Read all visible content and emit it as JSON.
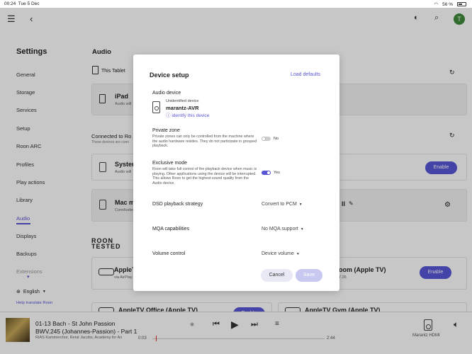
{
  "status_bar": {
    "time": "00:24",
    "date": "Tue 5 Dec",
    "battery": "56 %"
  },
  "top_bar": {
    "user_initial": "T"
  },
  "sidebar": {
    "title": "Settings",
    "items": [
      "General",
      "Storage",
      "Services",
      "Setup",
      "Roon ARC",
      "Profiles",
      "Play actions",
      "Library",
      "Audio",
      "Displays",
      "Backups",
      "Extensions"
    ],
    "active": "Audio",
    "language": "English",
    "help_link": "Help translate Roon"
  },
  "main": {
    "title": "Audio",
    "this_tablet": "This Tablet",
    "ipad_title": "iPad",
    "ipad_sub": "Audio will",
    "connected_header": "Connected to Ro",
    "connected_sub": "These devices are conn",
    "system_title": "System",
    "system_sub": "Audio will",
    "mac_title": "Mac m",
    "mac_sub": "CoreAudio",
    "grey_card_suffix": "ll",
    "enable_label": "Enable",
    "roon_tested": "ROON TESTED",
    "appletv1_title": "AppleT",
    "appletv1_sub": "via AirPlay",
    "appletv2_title": "oom (Apple TV)",
    "appletv2_sub": "7.26",
    "appletv_office": "AppleTV Office (Apple TV)",
    "appletv_gym": "AppleTV Gym (Apple TV)"
  },
  "dialog": {
    "title": "Device setup",
    "load_defaults": "Load defaults",
    "audio_device_label": "Audio device",
    "device_status": "Unidentified device",
    "device_name": "marantz-AVR",
    "identify_link": "identify this device",
    "private_zone": {
      "label": "Private zone",
      "description": "Private zones can only be controlled from the machine where the audio hardware resides. They do not participate in grouped playback.",
      "value": "No"
    },
    "exclusive_mode": {
      "label": "Exclusive mode",
      "description": "Roon will take full control of the playback device when music is playing. Other applications using the device will be interrupted. This allows Roon to get the highest sound quality from the Audio device.",
      "value": "Yes"
    },
    "dsd_strategy": {
      "label": "DSD playback strategy",
      "value": "Convert to PCM"
    },
    "mqa": {
      "label": "MQA capabilities",
      "value": "No MQA support"
    },
    "volume": {
      "label": "Volume control",
      "value": "Device volume"
    },
    "cancel": "Cancel",
    "save": "Save"
  },
  "player": {
    "line1": "01-13 Bach - St John Passion",
    "line2": "BWV.245 (Johannes-Passion) - Part 1",
    "line3": "RIAS Kammerchor, René Jacobs, Academy for An",
    "elapsed": "0:03",
    "duration": "2:44",
    "zone": "Marantz HDMI",
    "progress": 0.02
  },
  "colors": {
    "accent": "#5856d6",
    "avatar": "#3f8a3a"
  }
}
